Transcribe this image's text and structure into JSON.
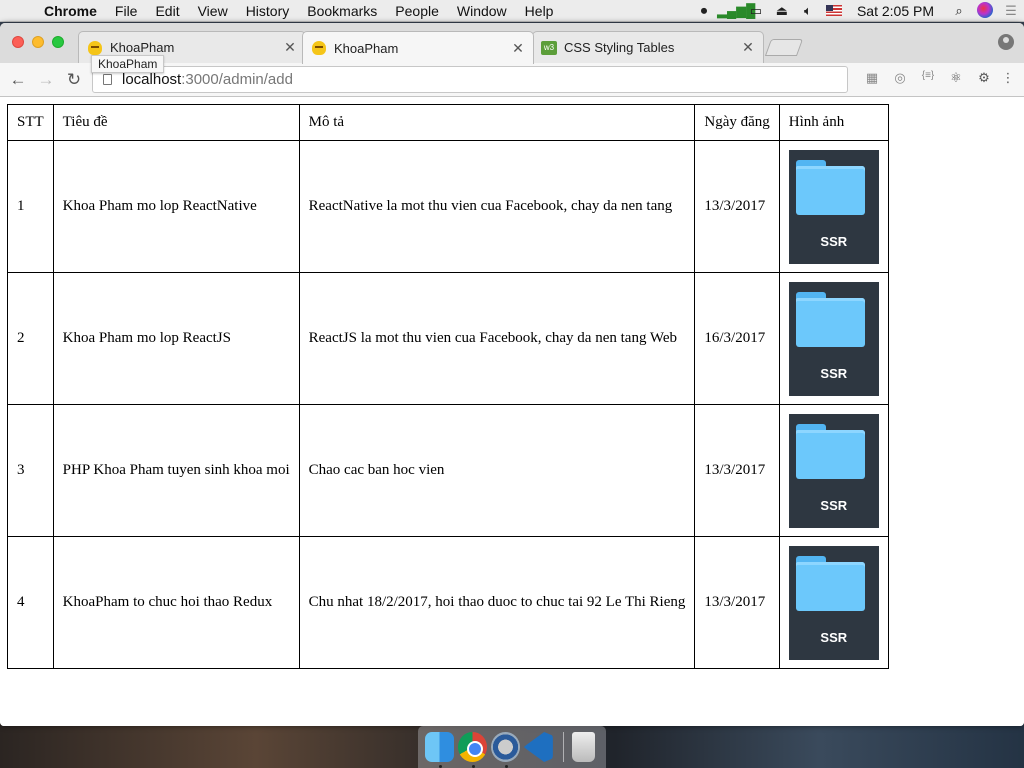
{
  "menubar": {
    "app_name": "Chrome",
    "items": [
      "File",
      "Edit",
      "View",
      "History",
      "Bookmarks",
      "People",
      "Window",
      "Help"
    ],
    "clock": "Sat 2:05 PM"
  },
  "tabs": [
    {
      "title": "KhoaPham",
      "active": false,
      "favicon": "khoapham-favicon-icon"
    },
    {
      "title": "KhoaPham",
      "active": true,
      "favicon": "khoapham-favicon-icon"
    },
    {
      "title": "CSS Styling Tables",
      "active": false,
      "favicon": "w3schools-favicon-icon"
    }
  ],
  "tooltip": "KhoaPham",
  "address_bar": {
    "host": "localhost",
    "path": ":3000/admin/add"
  },
  "table": {
    "headers": [
      "STT",
      "Tiêu đề",
      "Mô tả",
      "Ngày đăng",
      "Hình ảnh"
    ],
    "rows": [
      {
        "stt": "1",
        "title": "Khoa Pham mo lop ReactNative",
        "desc": "ReactNative la mot thu vien cua Facebook, chay da nen tang",
        "date": "13/3/2017",
        "image_label": "SSR"
      },
      {
        "stt": "2",
        "title": "Khoa Pham mo lop ReactJS",
        "desc": "ReactJS la mot thu vien cua Facebook, chay da nen tang Web",
        "date": "16/3/2017",
        "image_label": "SSR"
      },
      {
        "stt": "3",
        "title": "PHP Khoa Pham tuyen sinh khoa moi",
        "desc": "Chao cac ban hoc vien",
        "date": "13/3/2017",
        "image_label": "SSR"
      },
      {
        "stt": "4",
        "title": "KhoaPham to chuc hoi thao Redux",
        "desc": "Chu nhat 18/2/2017, hoi thao duoc to chuc tai 92 Le Thi Rieng",
        "date": "13/3/2017",
        "image_label": "SSR"
      }
    ]
  },
  "dock": {
    "apps": [
      "finder-icon",
      "chrome-icon",
      "quicktime-icon",
      "vscode-icon",
      "trash-icon"
    ]
  },
  "colors": {
    "traffic_close": "#fc5f57",
    "traffic_minimize": "#fdbc2e",
    "traffic_maximize": "#28c840",
    "folder_blue": "#6cc8fb",
    "thumb_background": "#2e3741"
  }
}
